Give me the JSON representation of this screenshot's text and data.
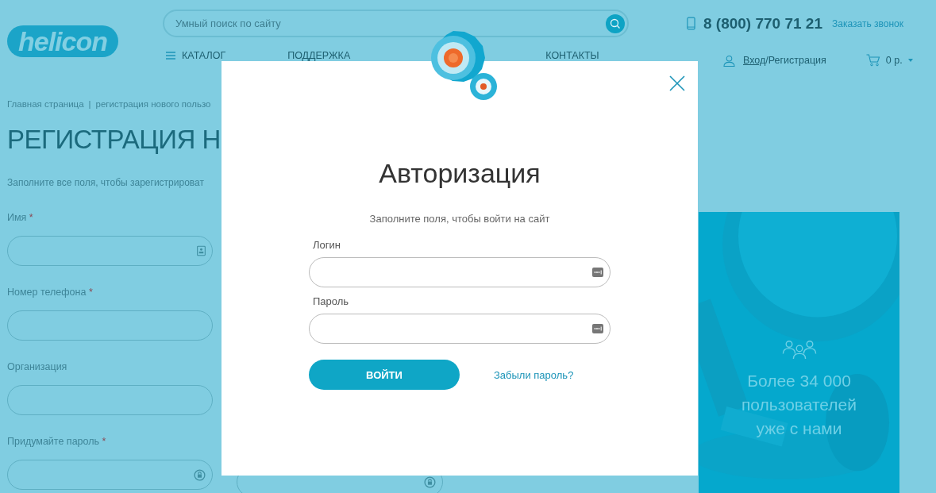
{
  "header": {
    "logo": "helicon",
    "search": {
      "placeholder": "Умный поиск по сайту"
    },
    "phone": "8 (800) 770 71 21",
    "callback_link": "Заказать звонок",
    "nav": [
      "КАТАЛОГ",
      "ПОДДЕРЖКА",
      "КОНТАКТЫ"
    ],
    "login_link": "Вход",
    "register_link": "/Регистрация",
    "cart": "0 р."
  },
  "breadcrumbs": {
    "items": [
      "Главная страница",
      "регистрация нового пользо"
    ],
    "separator": "|"
  },
  "page_title": "РЕГИСТРАЦИЯ Н",
  "page_subtitle": "Заполните все поля, чтобы зарегистрироват",
  "form": {
    "required_mark": "*",
    "fields": [
      {
        "label": "Имя",
        "required": true,
        "kind": "contact"
      },
      {
        "label": "Номер телефона",
        "required": true,
        "kind": "plain"
      },
      {
        "label": "Организация",
        "required": false,
        "kind": "plain"
      },
      {
        "label": "Придумайте пароль",
        "required": true,
        "kind": "password"
      }
    ],
    "second_column_fields": [
      {
        "kind": "password"
      }
    ]
  },
  "banner": {
    "kind": "picture",
    "lines": [
      "Более 34 000",
      "пользователей",
      "уже с нами"
    ]
  },
  "modal": {
    "title": "Авторизация",
    "subtitle": "Заполните поля, чтобы войти на сайт",
    "fields": [
      {
        "label": "Логин"
      },
      {
        "label": "Пароль"
      }
    ],
    "submit": "ВОЙТИ",
    "forgot_link": "Забыли пароль?"
  }
}
